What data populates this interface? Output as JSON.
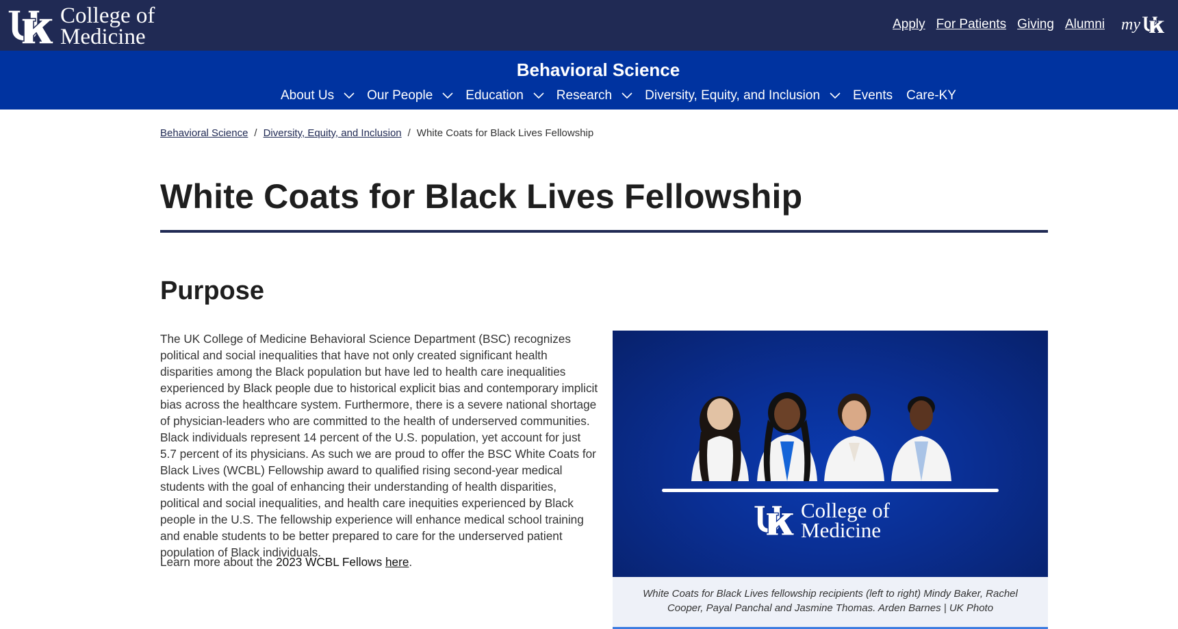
{
  "header": {
    "logo_line1": "College of",
    "logo_line2": "Medicine",
    "links": [
      "Apply",
      "For Patients",
      "Giving",
      "Alumni"
    ],
    "myuk_label": "my"
  },
  "dept": {
    "title": "Behavioral Science",
    "nav": [
      {
        "label": "About Us",
        "has_menu": true
      },
      {
        "label": "Our People",
        "has_menu": true
      },
      {
        "label": "Education",
        "has_menu": true
      },
      {
        "label": "Research",
        "has_menu": true
      },
      {
        "label": "Diversity, Equity, and Inclusion",
        "has_menu": true
      },
      {
        "label": "Events",
        "has_menu": false
      },
      {
        "label": "Care-KY",
        "has_menu": false
      }
    ]
  },
  "breadcrumb": {
    "items": [
      "Behavioral Science",
      "Diversity, Equity, and Inclusion"
    ],
    "current": "White Coats for Black Lives Fellowship",
    "separator": "/"
  },
  "page": {
    "title": "White Coats for Black Lives Fellowship",
    "section_heading": "Purpose",
    "body": "The UK College of Medicine Behavioral Science Department (BSC) recognizes political and social inequalities that have not only created significant health disparities among the Black population but have led to health care inequalities experienced by Black people due to historical explicit bias and contemporary implicit bias across the healthcare system. Furthermore, there is a severe national shortage of physician-leaders who are committed to the health of underserved communities. Black individuals represent 14 percent of the U.S. population, yet account for just 5.7 percent of its physicians. As such we are proud to offer the BSC White Coats for Black Lives (WCBL) Fellowship award to qualified rising second-year medical students with the goal of enhancing their understanding of health disparities, political and social inequalities, and health care inequities experienced by Black people in the U.S. The fellowship experience will enhance medical school training and enable students to be better prepared to care for the underserved patient population of Black individuals.",
    "learn_prefix": "Learn more about the ",
    "learn_strong": "2023 WCBL Fellows",
    "learn_link": "here",
    "learn_suffix": "."
  },
  "figure": {
    "logo_line1": "College of",
    "logo_line2": "Medicine",
    "caption": "White Coats for Black Lives fellowship recipients (left to right) Mindy Baker, Rachel Cooper, Payal Panchal and Jasmine Thomas. Arden Barnes | UK Photo"
  },
  "colors": {
    "navy": "#202a54",
    "blue": "#0033a0",
    "caption_bg": "#eef1f8",
    "caption_rule": "#3c7be0"
  },
  "icons": [
    "uk-logo-icon",
    "chevron-down-icon",
    "myuk-icon"
  ]
}
